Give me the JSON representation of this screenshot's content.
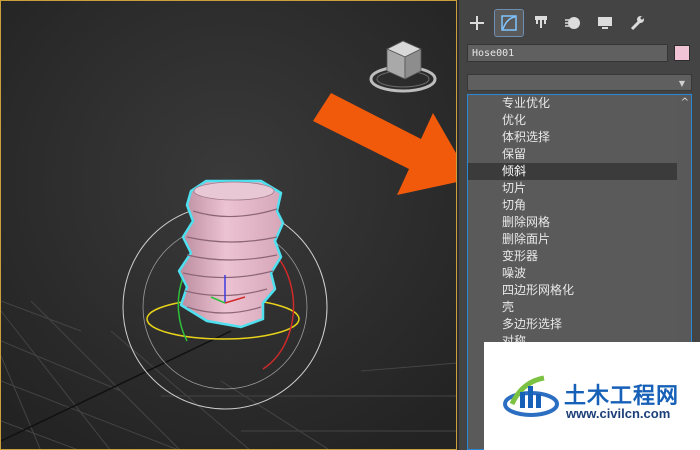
{
  "command_panel": {
    "tabs": [
      {
        "name": "create-tab",
        "icon": "plus-icon"
      },
      {
        "name": "modify-tab",
        "icon": "modify-icon",
        "active": true
      },
      {
        "name": "hierarchy-tab",
        "icon": "hierarchy-icon"
      },
      {
        "name": "motion-tab",
        "icon": "motion-icon"
      },
      {
        "name": "display-tab",
        "icon": "display-icon"
      },
      {
        "name": "utilities-tab",
        "icon": "wrench-icon"
      }
    ],
    "object_name": "Hose001",
    "object_color": "#f0c4d4",
    "modifier_dropdown_value": "",
    "modifier_list": [
      "专业优化",
      "优化",
      "体积选择",
      "保留",
      "倾斜",
      "切片",
      "切角",
      "删除网格",
      "删除面片",
      "变形器",
      "噪波",
      "四边形网格化",
      "壳",
      "多边形选择",
      "对称"
    ],
    "selected_modifier": "倾斜"
  },
  "watermark": {
    "title": "土木工程网",
    "url": "www.civilcn.com"
  },
  "colors": {
    "accent_arrow": "#f15a0b",
    "selection_outline": "#4fe0f0",
    "list_border": "#2a86d6",
    "viewport_border": "#c9a03a"
  }
}
